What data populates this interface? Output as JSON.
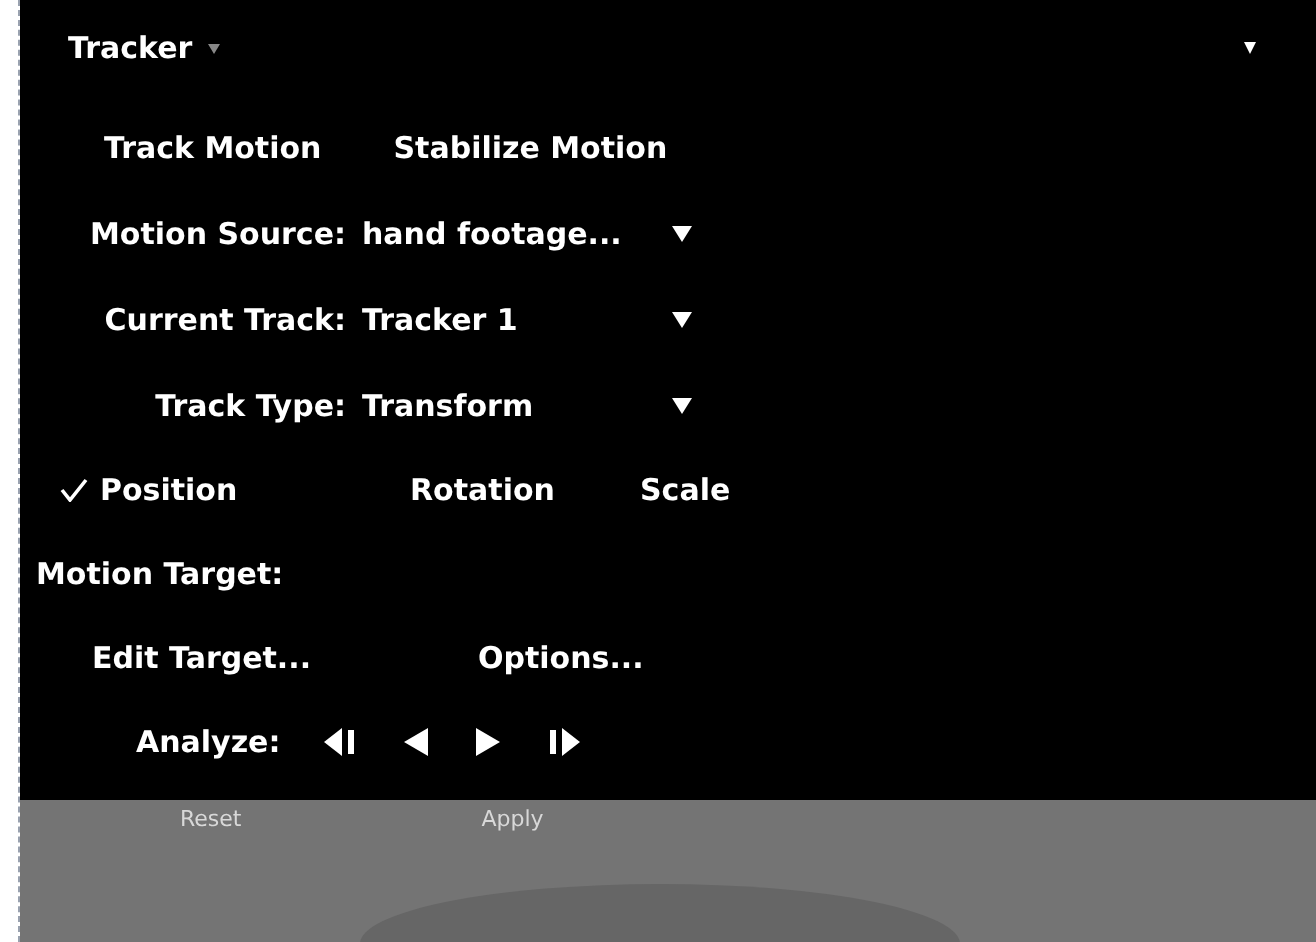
{
  "panel": {
    "title": "Tracker"
  },
  "mode_buttons": [
    "Track Motion",
    "Stabilize Motion"
  ],
  "fields": [
    {
      "label": "Motion Source:",
      "value": "hand footage..."
    },
    {
      "label": "Current Track:",
      "value": "Tracker 1"
    },
    {
      "label": "Track Type:",
      "value": "Transform"
    }
  ],
  "options": [
    {
      "label": "Position",
      "checked": true
    },
    {
      "label": "Rotation",
      "checked": false
    },
    {
      "label": "Scale",
      "checked": false
    }
  ],
  "motion_target": {
    "label": "Motion Target:"
  },
  "target_buttons": [
    "Edit Target...",
    "Options..."
  ],
  "analyze": {
    "label": "Analyze:",
    "buttons": [
      {
        "kind": "back-one"
      },
      {
        "kind": "back"
      },
      {
        "kind": "forward"
      },
      {
        "kind": "forward-one"
      }
    ]
  },
  "footer_buttons": [
    "Reset",
    "Apply"
  ]
}
